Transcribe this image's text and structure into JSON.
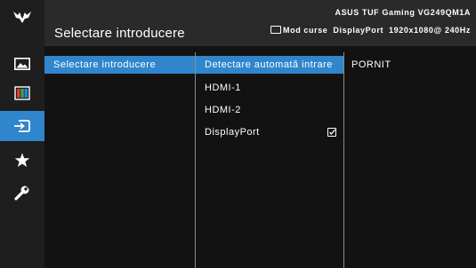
{
  "header": {
    "title": "Selectare introducere",
    "model": "ASUS TUF Gaming  VG249QM1A",
    "mode_label": "Mod curse",
    "input_label": "DisplayPort",
    "resolution": "1920x1080@ 240Hz"
  },
  "sidebar": {
    "items": [
      {
        "icon": "tuf-logo-icon"
      },
      {
        "icon": "image-icon"
      },
      {
        "icon": "color-icon"
      },
      {
        "icon": "input-select-icon",
        "active": true
      },
      {
        "icon": "star-icon"
      },
      {
        "icon": "wrench-icon"
      }
    ]
  },
  "menu": {
    "level1": [
      "Selectare introducere"
    ],
    "level2": [
      "Detectare automată intrare",
      "HDMI-1",
      "HDMI-2",
      "DisplayPort"
    ],
    "level3": [
      "PORNIT"
    ]
  },
  "colors": {
    "accent": "#2f86cc",
    "background": "#121212",
    "header": "#2a2a2a",
    "sidebar": "#1e1e1e"
  }
}
